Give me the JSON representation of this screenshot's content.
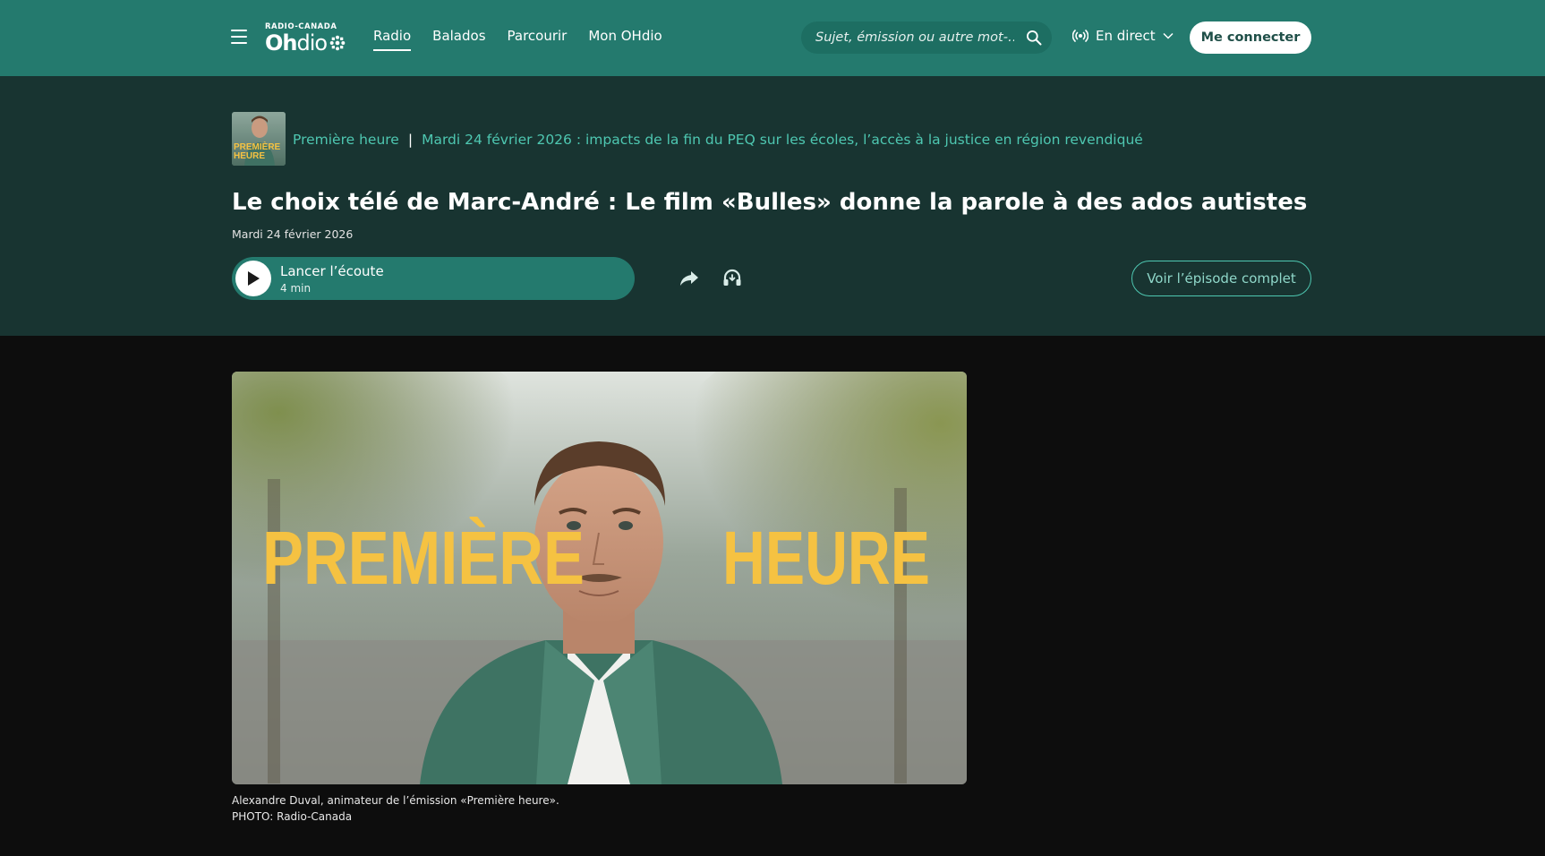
{
  "header": {
    "logo_top": "RADIO-CANADA",
    "logo_oh": "Oh",
    "logo_dio": "dio",
    "nav": [
      {
        "label": "Radio",
        "active": true
      },
      {
        "label": "Balados",
        "active": false
      },
      {
        "label": "Parcourir",
        "active": false
      },
      {
        "label": "Mon OHdio",
        "active": false
      }
    ],
    "search_placeholder": "Sujet, émission ou autre mot-…",
    "live_label": "En direct",
    "connect_label": "Me connecter"
  },
  "hero": {
    "show_thumb_text": "PREMIÈRE HEURE",
    "show_name": "Première heure",
    "separator": "|",
    "episode_link": "Mardi 24 février 2026 : impacts de la fin du PEQ sur les écoles, l’accès à la justice en région revendiqué",
    "title": "Le choix télé de Marc-André : Le film «Bulles» donne la parole à des ados autistes",
    "date": "Mardi 24 février 2026",
    "player_label": "Lancer l’écoute",
    "player_duration": "4 min",
    "full_episode_label": "Voir l’épisode complet"
  },
  "media": {
    "image_text_left": "PREMIÈRE",
    "image_text_right": "HEURE",
    "caption_line1": "Alexandre Duval, animateur de l’émission «Première heure».",
    "caption_line2": "PHOTO: Radio-Canada"
  },
  "colors": {
    "header_bg": "#247a6e",
    "hero_bg": "#183431",
    "accent": "#4ec7b1",
    "page_bg": "#0d0d0d",
    "title_yellow": "#f5c242"
  },
  "icons": [
    "menu-icon",
    "search-icon",
    "broadcast-icon",
    "chevron-down-icon",
    "play-icon",
    "share-icon",
    "headphones-icon"
  ]
}
